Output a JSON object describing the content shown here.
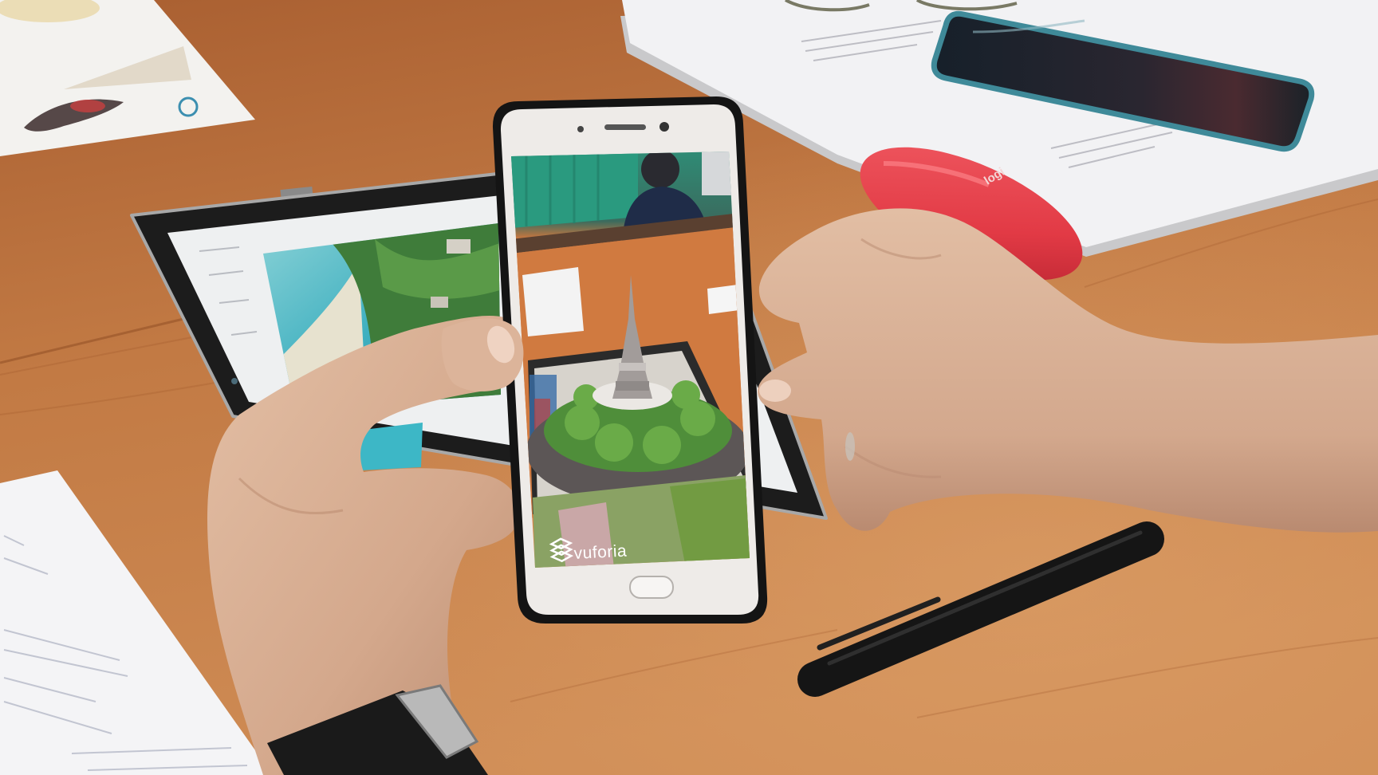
{
  "phone": {
    "screen_watermark": "vuforia",
    "watermark_icon": "vuforia-logo-icon"
  },
  "mouse": {
    "logo_text": "logi"
  },
  "colors": {
    "table_wood": "#c27a44",
    "phone_case": "#141414",
    "phone_body": "#eeebe8",
    "mouse_red": "#e23a45",
    "skin": "#d8b096",
    "pen": "#151515",
    "model_trees": "#4f8e3a"
  }
}
